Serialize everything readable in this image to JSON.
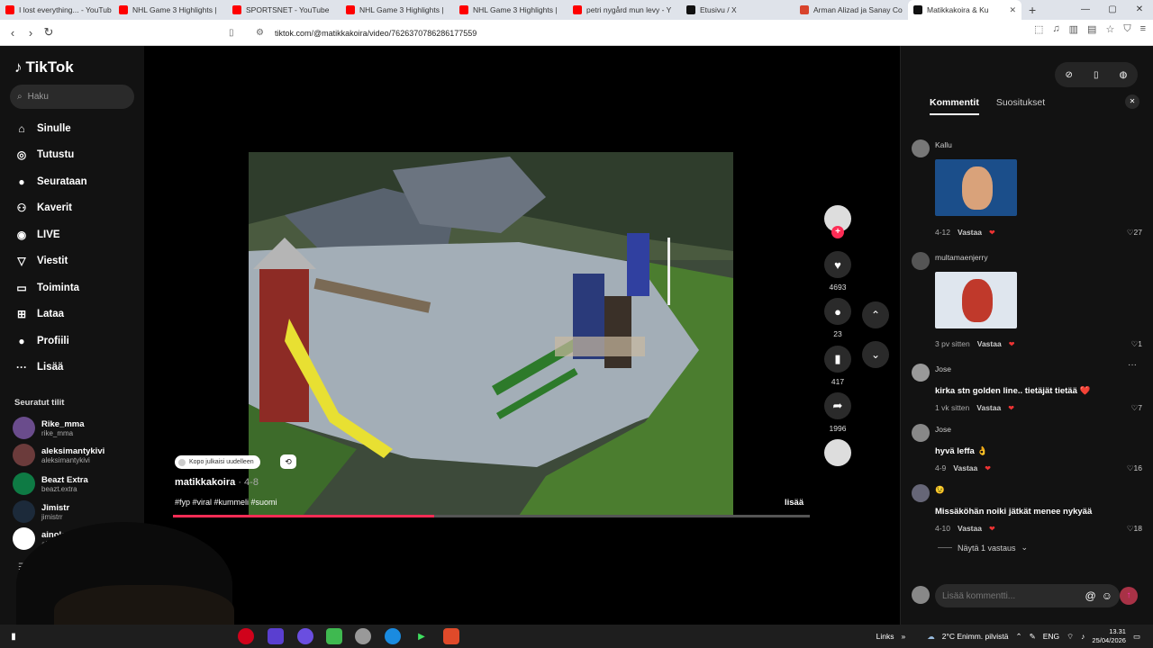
{
  "browser": {
    "tabs": [
      {
        "title": "I lost everything... - YouTub",
        "color": "#ff0000"
      },
      {
        "title": "NHL Game 3 Highlights |",
        "color": "#ff0000"
      },
      {
        "title": "SPORTSNET - YouTube",
        "color": "#ff0000"
      },
      {
        "title": "NHL Game 3 Highlights |",
        "color": "#ff0000"
      },
      {
        "title": "NHL Game 3 Highlights |",
        "color": "#ff0000"
      },
      {
        "title": "petri nygård mun levy - Y",
        "color": "#ff0000"
      },
      {
        "title": "Etusivu / X",
        "color": "#111111"
      },
      {
        "title": "Arman Alizad ja Sanay Co",
        "color": "#d8432c"
      },
      {
        "title": "Matikkakoira & Ku",
        "color": "#111111",
        "active": true
      }
    ],
    "url": "tiktok.com/@matikkakoira/video/7626370786286177559"
  },
  "sidebar": {
    "logo": "TikTok",
    "search_placeholder": "Haku",
    "menu": [
      {
        "label": "Sinulle",
        "icon": "home-icon",
        "glyph": "⌂"
      },
      {
        "label": "Tutustu",
        "icon": "compass-icon",
        "glyph": "◎"
      },
      {
        "label": "Seurataan",
        "icon": "following-avatar-icon",
        "glyph": "●"
      },
      {
        "label": "Kaverit",
        "icon": "friends-icon",
        "glyph": "⚇"
      },
      {
        "label": "LIVE",
        "icon": "live-icon",
        "glyph": "◉"
      },
      {
        "label": "Viestit",
        "icon": "messages-icon",
        "glyph": "▽"
      },
      {
        "label": "Toiminta",
        "icon": "activity-icon",
        "glyph": "▭"
      },
      {
        "label": "Lataa",
        "icon": "upload-icon",
        "glyph": "⊞"
      },
      {
        "label": "Profiili",
        "icon": "profile-avatar-icon",
        "glyph": "●"
      },
      {
        "label": "Lisää",
        "icon": "more-icon",
        "glyph": "···"
      }
    ],
    "followed_title": "Seuratut tilit",
    "followed": [
      {
        "name": "Rike_mma",
        "handle": "rike_mma",
        "color": "#6a4c8c"
      },
      {
        "name": "aleksimantykivi",
        "handle": "aleksimantykivi",
        "color": "#6b3b3b"
      },
      {
        "name": "Beazt Extra",
        "handle": "beazt.extra",
        "color": "#0e7a44"
      },
      {
        "name": "Jimistr",
        "handle": "jimistrr",
        "color": "#1c2a3a"
      },
      {
        "name": "ainolottaro",
        "handle": "ainolottaro",
        "color": "#ffffff"
      }
    ]
  },
  "video": {
    "badge": "Kopo julkaisi uudelleen",
    "author": "matikkakoira",
    "date": "· 4-8",
    "tags": "#fyp #viral #kummeli #suomi",
    "more_label": "lisää",
    "progress": 0.41
  },
  "rail": {
    "likes": "4693",
    "comments": "23",
    "saves": "417",
    "shares": "1996"
  },
  "panel": {
    "tab_comments": "Kommentit",
    "tab_recommended": "Suositukset",
    "comments": [
      {
        "user": "Kallu",
        "text": "",
        "meta": "4-12",
        "reply": "Vastaa",
        "likes": "27",
        "has_image": true
      },
      {
        "user": "multamaenjerry",
        "text": "",
        "meta": "3 pv sitten",
        "reply": "Vastaa",
        "likes": "1",
        "has_image": true
      },
      {
        "user": "Jose",
        "text": "kirka stn golden line.. tietäjät tietää ❤️",
        "meta": "1 vk sitten",
        "reply": "Vastaa",
        "likes": "7"
      },
      {
        "user": "Jose",
        "text": "hyvä leffa 👌",
        "meta": "4-9",
        "reply": "Vastaa",
        "likes": "16"
      },
      {
        "user": "😉",
        "text": "Missäköhän noiki jätkät menee nykyää",
        "meta": "4-10",
        "reply": "Vastaa",
        "likes": "18"
      }
    ],
    "show_replies": "Näytä 1 vastaus",
    "input_placeholder": "Lisää kommentti..."
  },
  "taskbar": {
    "links": "Links",
    "weather": "2°C  Enimm. pilvistä",
    "lang": "ENG",
    "time": "13.31",
    "date": "25/04/2026"
  }
}
